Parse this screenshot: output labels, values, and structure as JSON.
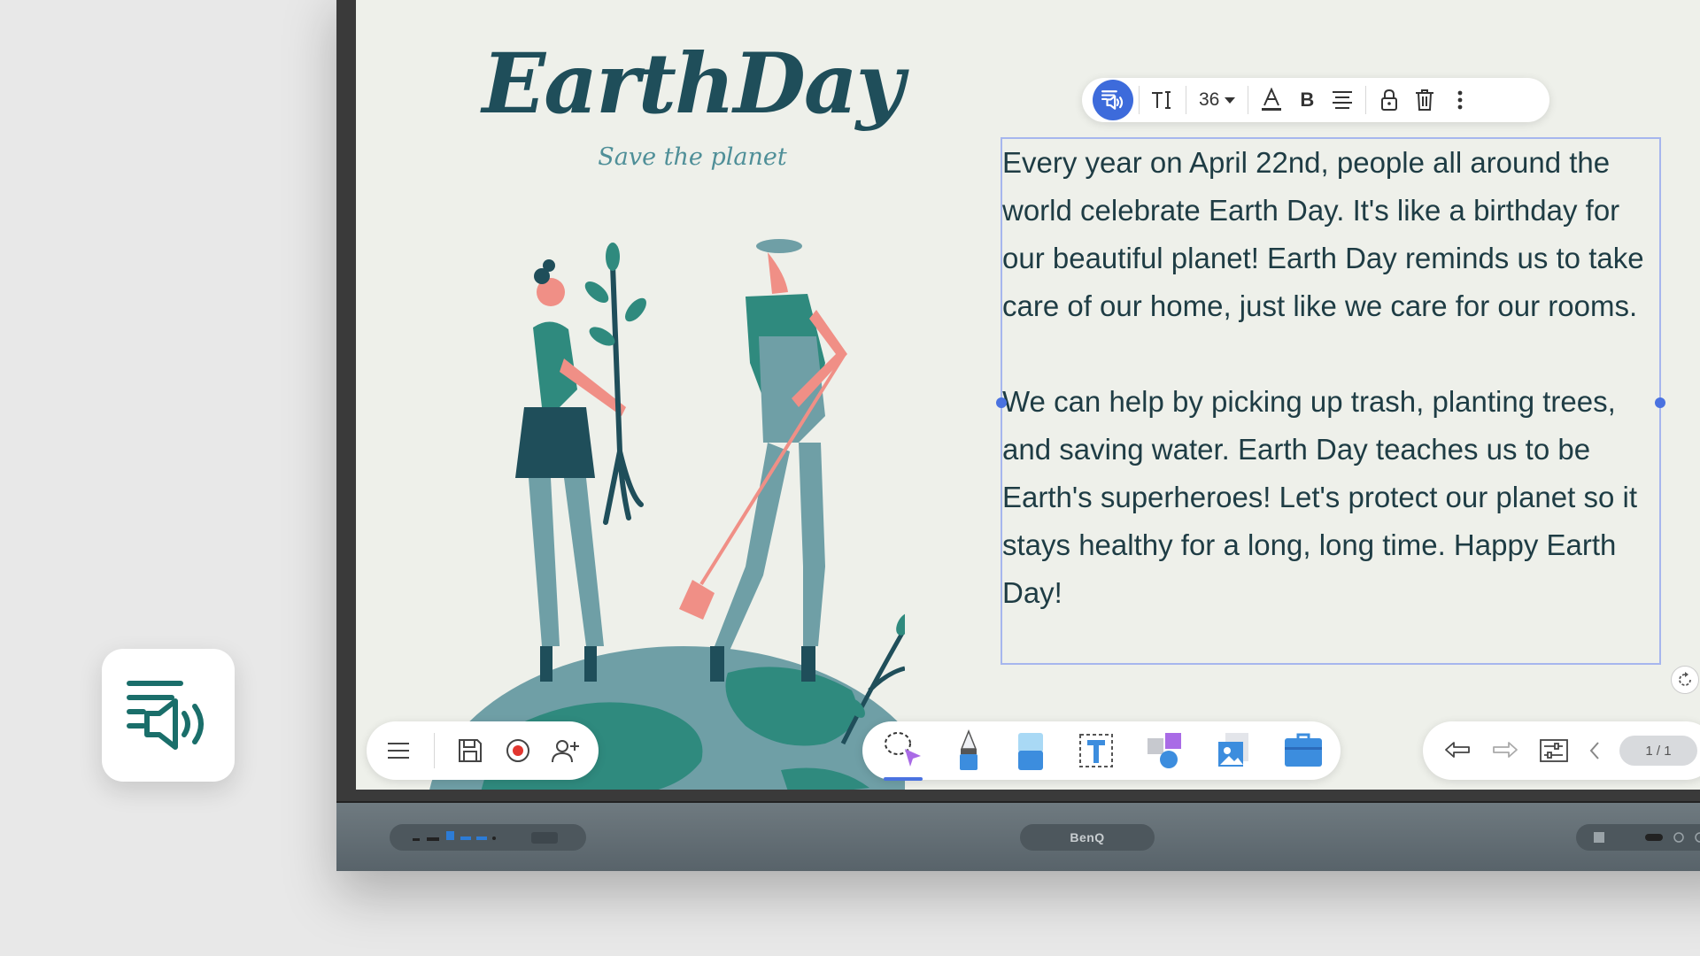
{
  "feature_tile": {
    "icon": "text-to-speech-icon"
  },
  "slide": {
    "title": "EarthDay",
    "subtitle": "Save the planet"
  },
  "text_toolbar": {
    "font_size_value": "36",
    "bold_label": "B"
  },
  "text_box": {
    "content": "Every year on April 22nd, people all around the world celebrate Earth Day. It's like a birthday for our beautiful planet! Earth Day reminds us to take care of our home, just like we care for our rooms.\n\nWe can help by picking up trash, planting trees, and saving water. Earth Day teaches us to be Earth's superheroes! Let's protect our planet so it stays healthy for a long, long time. Happy Earth Day!"
  },
  "page_indicator": "1 / 1",
  "bezel": {
    "brand": "BenQ"
  },
  "colors": {
    "accent": "#3d6bdb",
    "selection": "#a6b6ee",
    "title": "#1f4e5a",
    "canvas": "#eef0ea"
  }
}
